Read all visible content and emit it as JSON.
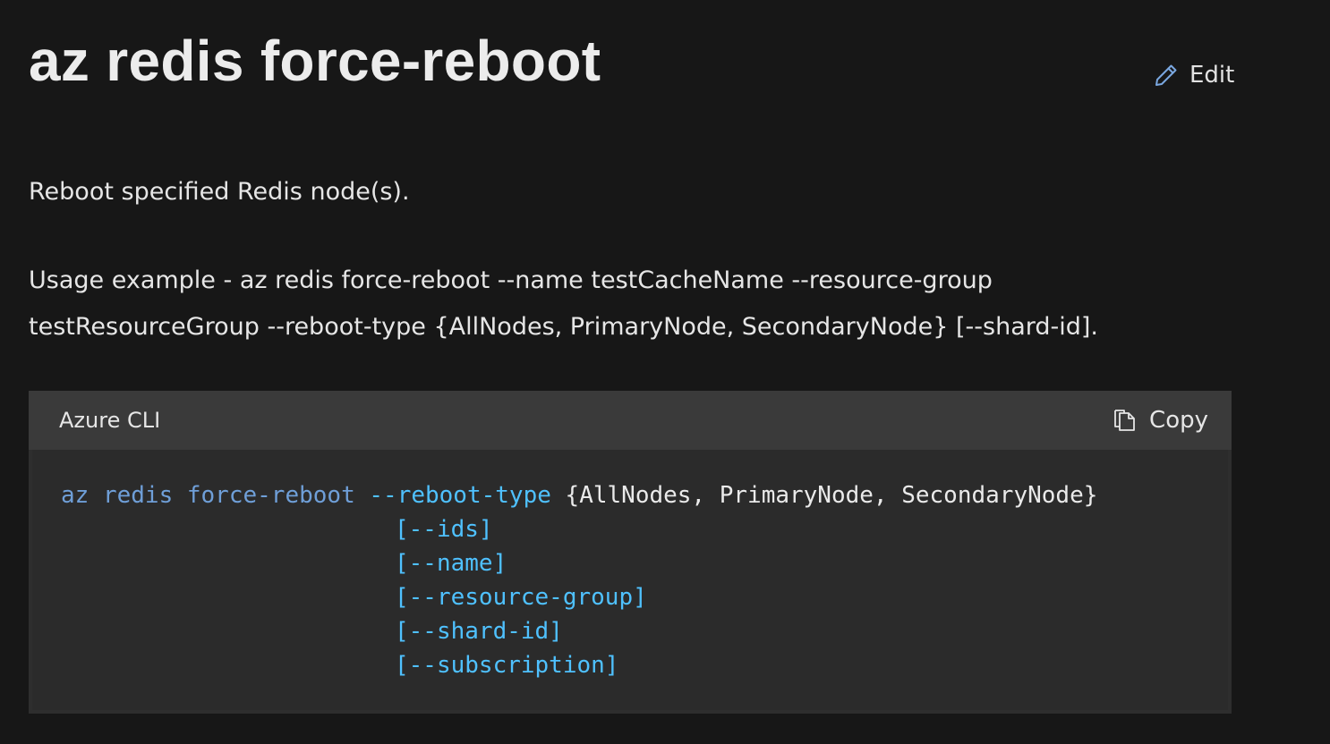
{
  "page": {
    "title": "az redis force-reboot",
    "edit_label": "Edit",
    "description": "Reboot specified Redis node(s).",
    "usage_line1": "Usage example - az redis force-reboot --name testCacheName --resource-group",
    "usage_line2": "testResourceGroup --reboot-type {AllNodes, PrimaryNode, SecondaryNode} [--shard-id]."
  },
  "code_block": {
    "language_label": "Azure CLI",
    "copy_label": "Copy",
    "command": "az redis force-reboot",
    "first_param": "--reboot-type",
    "first_value": "{AllNodes, PrimaryNode, SecondaryNode}",
    "optional_params": [
      "[--ids]",
      "[--name]",
      "[--resource-group]",
      "[--shard-id]",
      "[--subscription]"
    ]
  },
  "colors": {
    "background": "#171717",
    "code_header": "#3a3a3a",
    "code_body": "#2b2b2b",
    "command_token": "#6f9fd8",
    "param_token": "#4fc1ff"
  },
  "icons": {
    "edit": "pencil-icon",
    "copy": "copy-icon"
  }
}
